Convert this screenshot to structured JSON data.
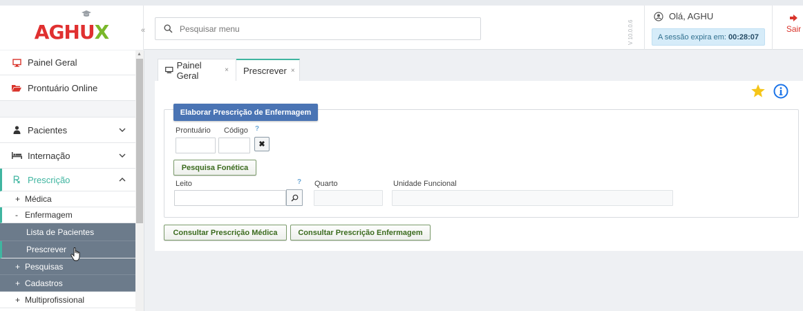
{
  "app": {
    "logo_text_1": "AGH",
    "logo_text_2": "U",
    "logo_text_3": "X"
  },
  "header": {
    "collapse_glyph": "«",
    "search_placeholder": "Pesquisar menu",
    "version": "V 10.0.0.6",
    "greeting": "Olá, AGHU",
    "session_label": "A sessão expira em:",
    "session_time": "00:28:07",
    "logout_label": "Sair"
  },
  "sidebar": {
    "items": [
      {
        "label": "Painel Geral",
        "icon": "monitor-icon"
      },
      {
        "label": "Prontuário Online",
        "icon": "folder-icon"
      },
      {
        "label": "Pacientes",
        "icon": "user-icon"
      },
      {
        "label": "Internação",
        "icon": "bed-icon"
      },
      {
        "label": "Prescrição",
        "icon": "prescription-icon"
      }
    ],
    "sub_items": {
      "medica": "Médica",
      "enfermagem": "Enfermagem",
      "lista_pacientes": "Lista de Pacientes",
      "prescrever": "Prescrever",
      "pesquisas": "Pesquisas",
      "cadastros": "Cadastros",
      "multiprofissional": "Multiprofissional"
    },
    "signs": {
      "plus": "+",
      "minus": "-"
    }
  },
  "tabs": [
    {
      "label": "Painel Geral",
      "close": "×"
    },
    {
      "label": "Prescrever",
      "close": "×"
    }
  ],
  "form": {
    "legend": "Elaborar Prescrição de Enfermagem",
    "prontuario_label": "Prontuário",
    "codigo_label": "Código",
    "help_glyph": "?",
    "clear_glyph": "✖",
    "fonetica_button": "Pesquisa Fonética",
    "leito_label": "Leito",
    "quarto_label": "Quarto",
    "unidade_label": "Unidade Funcional",
    "consultar_medica": "Consultar Prescrição Médica",
    "consultar_enfermagem": "Consultar Prescrição Enfermagem"
  },
  "colors": {
    "accent": "#3fb5a0",
    "legend_blue": "#4a74b4",
    "sidebar_dark": "#6c7b8b",
    "logout_red": "#d9342b",
    "button_green_text": "#3b6b1e"
  }
}
